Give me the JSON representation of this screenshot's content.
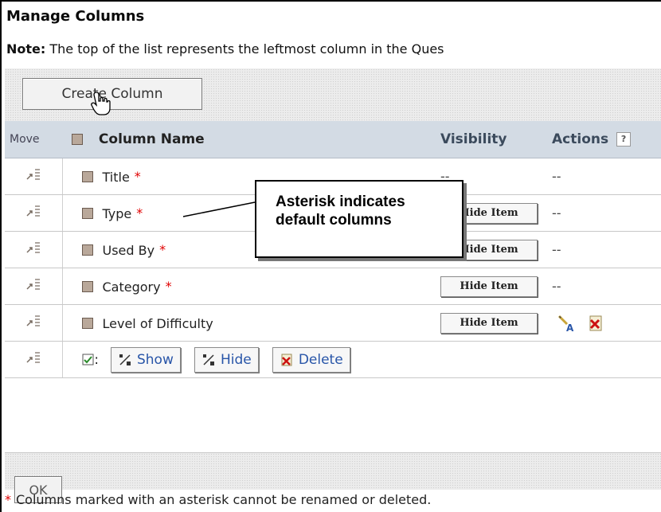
{
  "header": {
    "title": "Manage Columns",
    "note_label": "Note:",
    "note_text": " The top of the list represents the leftmost column in the Ques"
  },
  "toolbar": {
    "create_label": "Create Column"
  },
  "table": {
    "headers": {
      "move": "Move",
      "name": "Column Name",
      "visibility": "Visibility",
      "actions": "Actions",
      "help": "?"
    },
    "rows": [
      {
        "name": "Title",
        "asterisk": "*",
        "visibility": "--",
        "actions": "--"
      },
      {
        "name": "Type",
        "asterisk": "*",
        "visibility": "Hide Item",
        "actions": "--"
      },
      {
        "name": "Used By",
        "asterisk": "*",
        "visibility": "Hide Item",
        "actions": "--"
      },
      {
        "name": "Category",
        "asterisk": "*",
        "visibility": "Hide Item",
        "actions": "--"
      },
      {
        "name": "Level of Difficulty",
        "asterisk": "",
        "visibility": "Hide Item",
        "actions": ""
      }
    ],
    "bulk": {
      "checked_suffix": ":",
      "show_label": "Show",
      "hide_label": "Hide",
      "delete_label": "Delete"
    }
  },
  "callout": {
    "line1": "Asterisk indicates",
    "line2": "default columns"
  },
  "footer": {
    "ok_label": "OK",
    "asterisk": "*",
    "note": "Columns marked with an asterisk cannot be renamed or deleted."
  },
  "colors": {
    "asterisk": "#e00000",
    "header_bg": "#d3dbe4",
    "link": "#2855a8"
  }
}
